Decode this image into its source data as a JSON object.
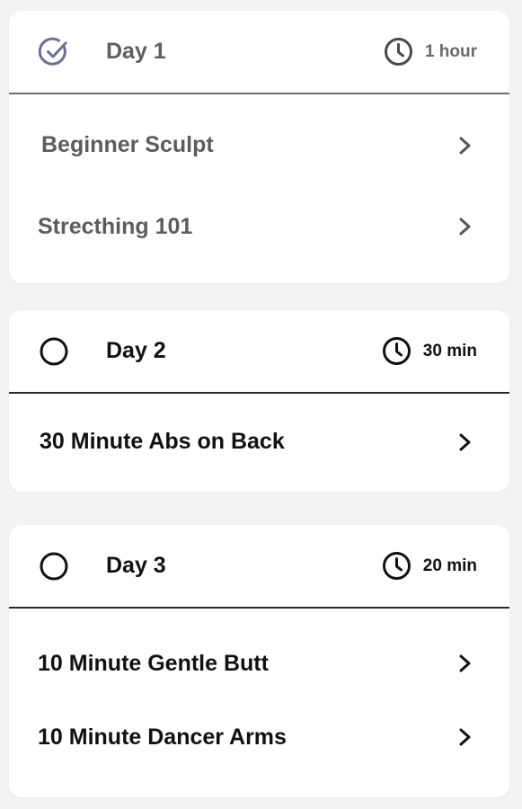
{
  "days": [
    {
      "title": "Day 1",
      "duration": "1 hour",
      "status_icon": "check-circle-icon",
      "completed": true,
      "workouts": [
        {
          "label": "Beginner Sculpt"
        },
        {
          "label": "Strecthing 101"
        }
      ]
    },
    {
      "title": "Day 2",
      "duration": "30 min",
      "status_icon": "empty-circle-icon",
      "completed": false,
      "workouts": [
        {
          "label": "30 Minute Abs on Back"
        }
      ]
    },
    {
      "title": "Day 3",
      "duration": "20 min",
      "status_icon": "empty-circle-icon",
      "completed": false,
      "workouts": [
        {
          "label": "10 Minute Gentle Butt"
        },
        {
          "label": "10 Minute Dancer Arms"
        }
      ]
    }
  ],
  "colors": {
    "check_accent": "#6b6f93",
    "text_primary": "#111111",
    "text_muted": "#5e5e5e",
    "background": "#f3f3f3",
    "card": "#ffffff"
  }
}
